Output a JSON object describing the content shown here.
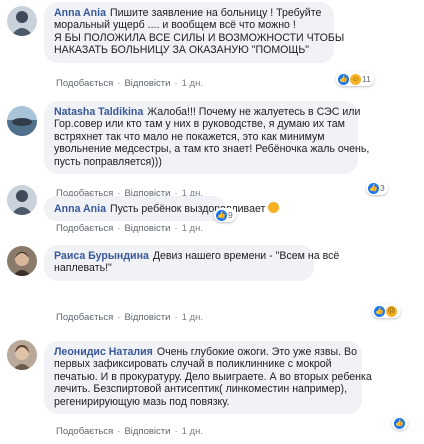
{
  "comments": [
    {
      "author": "Anna Ania",
      "lines": [
        "Пишите заявление на больницу ! Требуйте",
        "моральный ущерб .... и вообщем всё что можно !",
        "Я БЫ ПОЛОЖИЛА ВСЕ СИЛЫ И ВОЗМОЖНОСТИ ЧТОБЫ",
        "НАКАЗАТЬ БОЛЬНИЦУ ЗА ОКАЗАНУЮ \"ПОМОЩЬ\""
      ],
      "like_label": "Подобається",
      "reply_label": "Відповісти",
      "time": "1 дн.",
      "reaction_count": "11",
      "reaction_icons": [
        "like-icon",
        "haha-icon"
      ]
    },
    {
      "author": "Natasha Taldikina",
      "lines": [
        "Жалоба!!! Почему не жалуетесь в СЭС или",
        "Гор.совер или кто там у них в руководстве, я думаю их там",
        "встряхнет так что мало не покажется, это как минимум",
        "увольнение медсестры, а там кто знает! Ребёночка жаль очень,",
        "пусть поправляется)))"
      ],
      "like_label": "Подобається",
      "reply_label": "Відповісти",
      "time": "1 дн.",
      "reaction_count": "3",
      "reaction_icons": [
        "like-icon"
      ]
    },
    {
      "author": "Anna Ania",
      "lines": [
        "Пусть ребёнок выздоравливает"
      ],
      "like_label": "Подобається",
      "reply_label": "Відповісти",
      "time": "1 дн.",
      "reaction_count": "9",
      "reaction_icons": [
        "like-icon"
      ]
    },
    {
      "author": "Раиса Бурындина",
      "lines": [
        "Девиз нашего времени - \"Всем на всё",
        "наплевать!\""
      ],
      "like_label": "Подобається",
      "reply_label": "Відповісти",
      "time": "1 дн.",
      "reaction_count": "",
      "reaction_icons": [
        "like-icon",
        "sad-icon"
      ]
    },
    {
      "author": "Леонидис Наталия",
      "lines": [
        "Очень глубокие ожоги. Это уже язвы. Во",
        "первых зафиксировать случай в поликлиннике с мокрой",
        "печатью. И в прокуратуру. Дело выиграете. А во вторых ребенка",
        "лечить. Безспиртовой антисептик( линкоместин например),",
        "регенирирующую мазь под повязку."
      ],
      "like_label": "Подобається",
      "reply_label": "Відповісти",
      "time": "1 дн.",
      "reaction_count": "",
      "reaction_icons": [
        "like-icon"
      ]
    }
  ],
  "separator": "·",
  "colors": {
    "author": "#385898",
    "bubble": "#f0f2f5",
    "like": "#1877f2",
    "emoji": "#f7b125"
  }
}
